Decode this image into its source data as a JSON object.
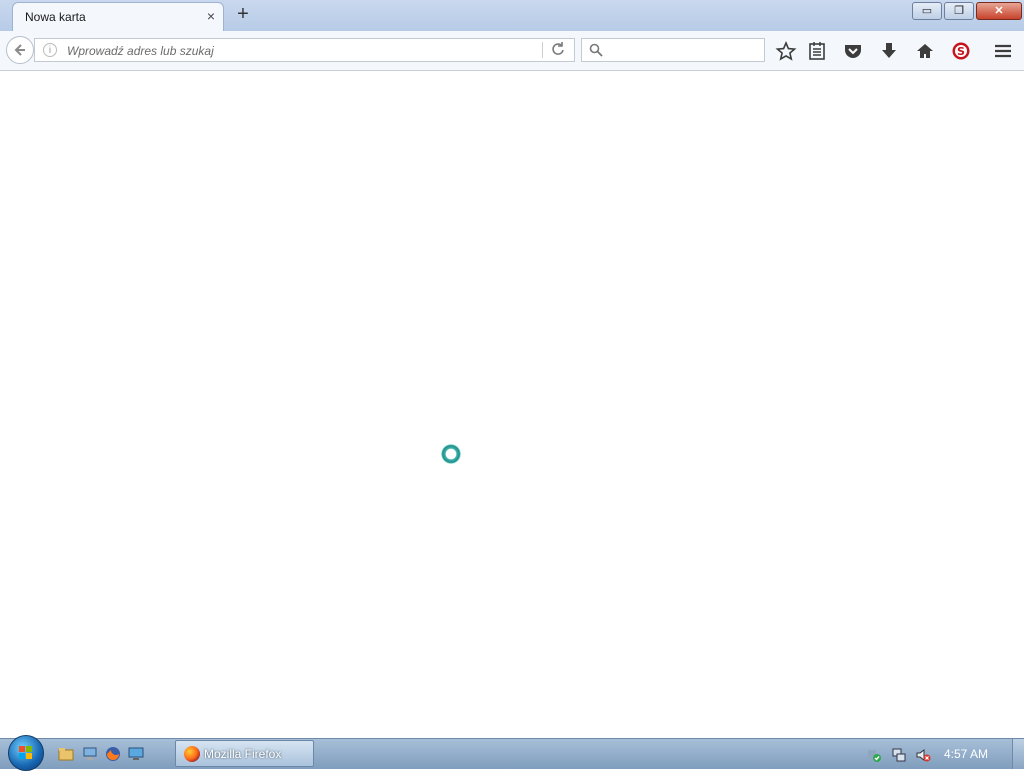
{
  "browser": {
    "tab": {
      "title": "Nowa karta",
      "close_symbol": "×"
    },
    "new_tab_symbol": "+",
    "window_buttons": {
      "minimize": "▭",
      "restore": "❐",
      "close": "✕"
    },
    "urlbar": {
      "placeholder": "Wprowadź adres lub szukaj",
      "value": ""
    },
    "searchbar": {
      "placeholder": "",
      "value": ""
    },
    "toolbar_icons": [
      "bookmark-star-icon",
      "reading-list-icon",
      "pocket-icon",
      "downloads-icon",
      "home-icon",
      "addon-s-icon",
      "menu-icon"
    ]
  },
  "taskbar": {
    "window_item": "Mozilla Firefox",
    "clock": "4:57 AM",
    "quick_launch_icons": [
      "file-explorer-icon",
      "network-places-icon",
      "firefox-icon",
      "remote-desktop-icon"
    ],
    "tray_icons": [
      "security-shield-icon",
      "network-icon",
      "speaker-muted-icon"
    ]
  },
  "colors": {
    "accent": "#44b7b0",
    "taskbar": "#8fabc9"
  }
}
